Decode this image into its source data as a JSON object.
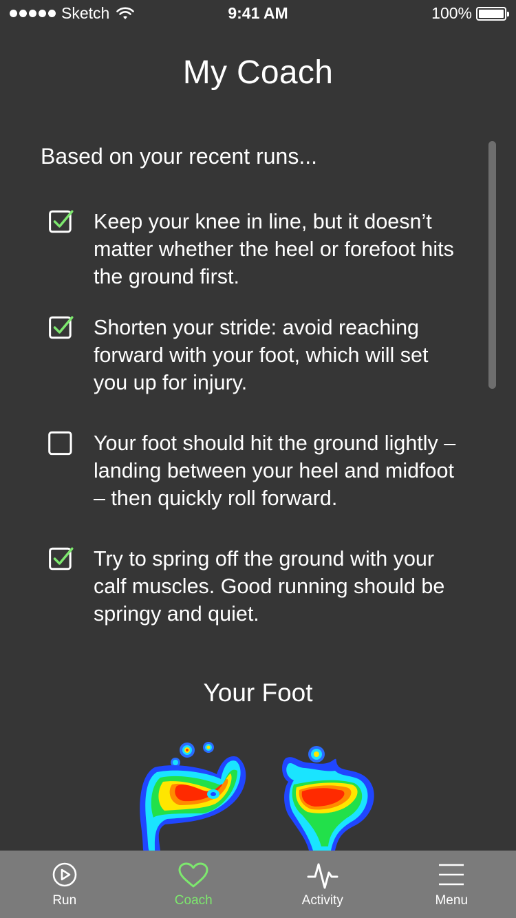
{
  "status_bar": {
    "carrier": "Sketch",
    "time": "9:41 AM",
    "battery_percent": "100%",
    "battery_level": 1.0
  },
  "header": {
    "title": "My Coach"
  },
  "coach": {
    "heading": "Based on your recent runs...",
    "tips": [
      {
        "text": "Keep your knee in line, but it doesn’t matter whether the heel or forefoot hits the ground first.",
        "checked": true
      },
      {
        "text": "Shorten your stride: avoid reaching forward with your foot, which will set you up for injury.",
        "checked": true
      },
      {
        "text": "Your foot should hit the ground lightly – landing between your heel and midfoot – then quickly roll forward.",
        "checked": false
      },
      {
        "text": "Try to spring off the ground with your calf muscles. Good running should be springy and quiet.",
        "checked": true
      }
    ]
  },
  "foot": {
    "title": "Your Foot"
  },
  "colors": {
    "background": "#363636",
    "tab_bar": "#7b7b7b",
    "accent": "#7de86e"
  },
  "tab_bar": {
    "tabs": [
      {
        "label": "Run",
        "icon": "play-circle-icon",
        "active": false
      },
      {
        "label": "Coach",
        "icon": "heart-icon",
        "active": true
      },
      {
        "label": "Activity",
        "icon": "pulse-icon",
        "active": false
      },
      {
        "label": "Menu",
        "icon": "hamburger-menu-icon",
        "active": false
      }
    ]
  }
}
